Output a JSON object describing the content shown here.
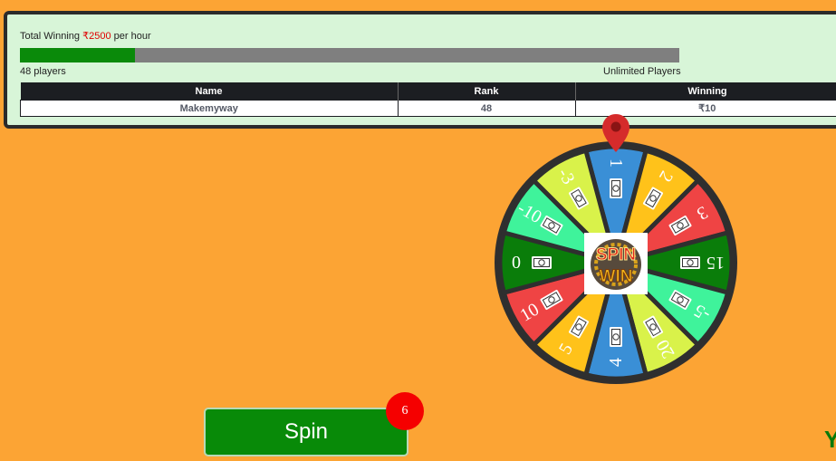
{
  "header": {
    "total_prefix": "Total Winning ",
    "total_amount": "₹2500",
    "total_suffix": " per hour",
    "progress_fraction": 0.175,
    "players_text": "48 players",
    "unlimited_text": "Unlimited Players"
  },
  "table": {
    "columns": [
      "Name",
      "Rank",
      "Winning"
    ],
    "rows": [
      {
        "name": "Makemyway",
        "rank": "48",
        "winning": "₹10"
      }
    ]
  },
  "wheel": {
    "segments": [
      {
        "label": "1",
        "color": "#3a8fd6"
      },
      {
        "label": "2",
        "color": "#ffc21a"
      },
      {
        "label": "3",
        "color": "#ef4444"
      },
      {
        "label": "15",
        "color": "#0a7d0a"
      },
      {
        "label": "-5",
        "color": "#3ff39b"
      },
      {
        "label": "20",
        "color": "#d9f24a"
      },
      {
        "label": "4",
        "color": "#3a8fd6"
      },
      {
        "label": "5",
        "color": "#ffc21a"
      },
      {
        "label": "10",
        "color": "#ef4444"
      },
      {
        "label": "0",
        "color": "#0a7d0a"
      },
      {
        "label": "-10",
        "color": "#3ff39b"
      },
      {
        "label": "-3",
        "color": "#d9f24a"
      }
    ],
    "logo_top": "SPIN",
    "logo_bottom": "WIN"
  },
  "spin_button": {
    "label": "Spin",
    "badge": "6"
  },
  "corner_text": "Y",
  "colors": {
    "background": "#fca434",
    "panel": "#d8f5d8",
    "progress_fill": "#0a8a0a",
    "button": "#088a08",
    "badge": "#f50000"
  }
}
